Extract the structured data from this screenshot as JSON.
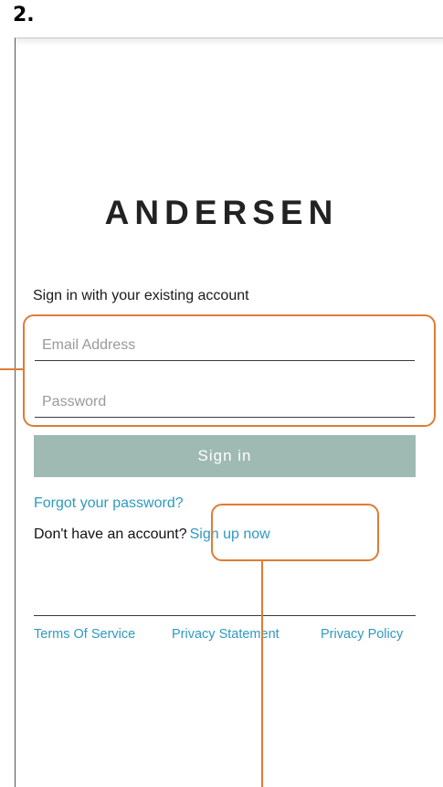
{
  "step_label": "2.",
  "brand": {
    "logo_text": "ANDERSEN"
  },
  "signin": {
    "subtitle": "Sign in with your existing account",
    "email_placeholder": "Email Address",
    "password_placeholder": "Password",
    "button_label": "Sign in",
    "forgot_password_link": "Forgot your password?",
    "no_account_text": "Don't have an account?",
    "signup_link": "Sign up now"
  },
  "footer": {
    "links": [
      "Terms Of Service",
      "Privacy Statement",
      "Privacy Policy"
    ]
  },
  "colors": {
    "accent_link": "#2f9ac0",
    "signin_button": "#9ebab3",
    "annotation": "#e07b35"
  }
}
